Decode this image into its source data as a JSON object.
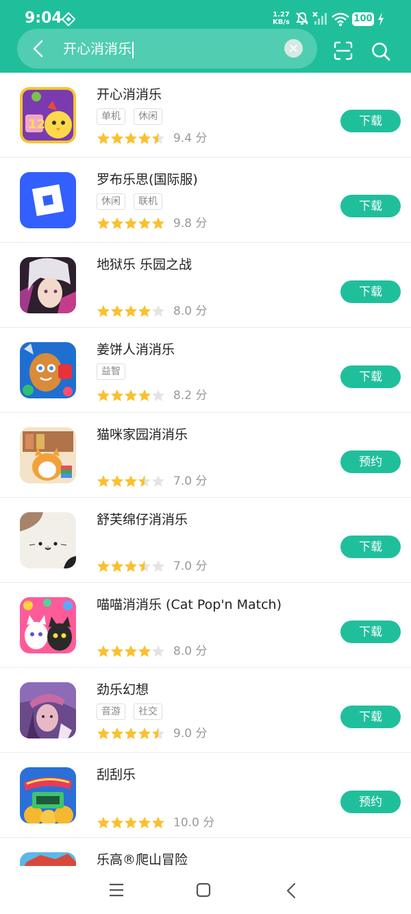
{
  "status_bar": {
    "time": "9:04",
    "speed_value": "1.27",
    "speed_unit": "KB/s",
    "battery": "100"
  },
  "search": {
    "query": "开心消消乐"
  },
  "colors": {
    "accent": "#20bf9c",
    "star": "#fbc02d",
    "star_empty": "#e4e4e4"
  },
  "results": [
    {
      "title": "开心消消乐",
      "tags": [
        "单机",
        "休闲"
      ],
      "rating": 4.5,
      "score": "9.4 分",
      "action": "下载"
    },
    {
      "title": "罗布乐思(国际服)",
      "tags": [
        "休闲",
        "联机"
      ],
      "rating": 5,
      "score": "9.8 分",
      "action": "下载"
    },
    {
      "title": "地狱乐 乐园之战",
      "tags": [],
      "rating": 4,
      "score": "8.0 分",
      "action": "下载"
    },
    {
      "title": "姜饼人消消乐",
      "tags": [
        "益智"
      ],
      "rating": 4,
      "score": "8.2 分",
      "action": "下载"
    },
    {
      "title": "猫咪家园消消乐",
      "tags": [],
      "rating": 3.5,
      "score": "7.0 分",
      "action": "预约"
    },
    {
      "title": "舒芙绵仔消消乐",
      "tags": [],
      "rating": 3.5,
      "score": "7.0 分",
      "action": "下载"
    },
    {
      "title": "喵喵消消乐 (Cat Pop'n Match)",
      "tags": [],
      "rating": 4,
      "score": "8.0 分",
      "action": "下载"
    },
    {
      "title": "劲乐幻想",
      "tags": [
        "音游",
        "社交"
      ],
      "rating": 4.5,
      "score": "9.0 分",
      "action": "下载"
    },
    {
      "title": "刮刮乐",
      "tags": [],
      "rating": 5,
      "score": "10.0 分",
      "action": "预约"
    },
    {
      "title": "乐高®爬山冒险",
      "tags": [],
      "rating": 0,
      "score": "",
      "action": ""
    }
  ]
}
